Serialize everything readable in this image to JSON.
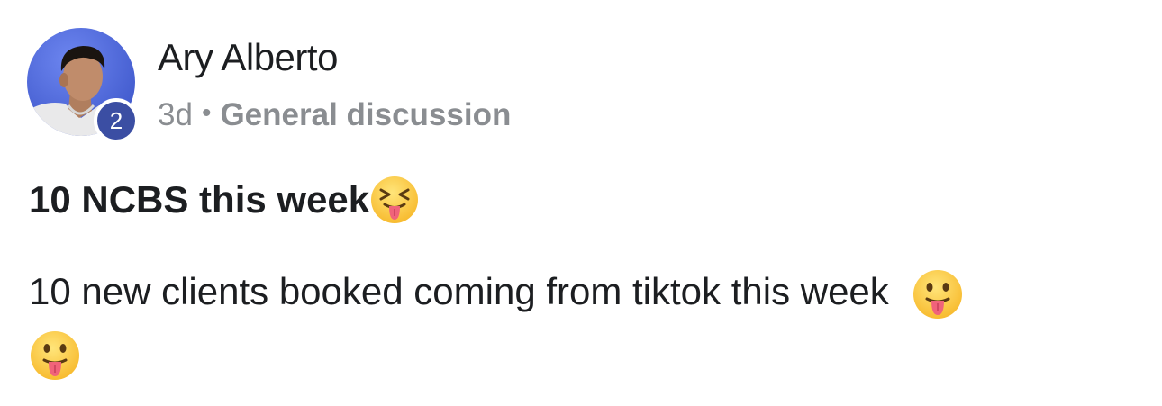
{
  "post": {
    "author": {
      "name": "Ary Alberto",
      "level_badge": "2"
    },
    "meta": {
      "time": "3d",
      "separator": "•",
      "group": "General discussion"
    },
    "title": "10 NCBS this week",
    "body_text": "10 new clients booked coming from tiktok this week",
    "emojis": {
      "title_emoji": "squinting-face-with-tongue",
      "body_emoji": "face-with-tongue"
    }
  },
  "colors": {
    "badge": "#3b4ea3",
    "meta_text": "#8a8d91",
    "text": "#1c1e21",
    "avatar_bg": "#4a63d8"
  }
}
